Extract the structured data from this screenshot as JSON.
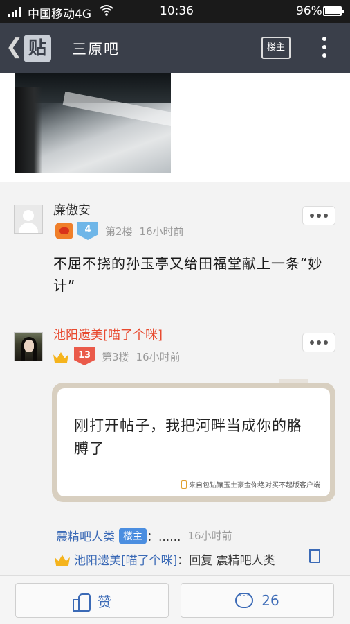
{
  "status_bar": {
    "carrier": "中国移动4G",
    "time": "10:36",
    "battery": "96%",
    "battery_level": 0.96
  },
  "nav": {
    "back_icon": "chevron-left-icon",
    "logo_text": "贴",
    "title": "三原吧",
    "louzhu_button": "楼主",
    "more_icon": "vertical-dots-icon"
  },
  "floors": [
    {
      "username": "廉傲安",
      "level": "4",
      "floor": "第2楼",
      "time": "16小时前",
      "content": "不屈不挠的孙玉亭又给田福堂献上一条“妙计”"
    },
    {
      "username": "池阳遗美[喵了个咪]",
      "level": "13",
      "floor": "第3楼",
      "time": "16小时前",
      "content": "刚打开帖子，我把河畔当成你的胳膊了",
      "source": "来自包钻镶玉土豪金你绝对买不起版客户端",
      "replies": [
        {
          "name": "震精吧人类",
          "tag": "楼主",
          "content": "：......",
          "time": "16小时前"
        },
        {
          "name": "池阳遗美[喵了个咪]",
          "content": "：回复 震精吧人类"
        }
      ]
    }
  ],
  "bottom": {
    "like_label": "赞",
    "comment_count": "26"
  },
  "colors": {
    "navbar": "#3a3f4a",
    "accent_blue": "#3b6ab6",
    "red_name": "#e84a2f",
    "quote_frame": "#d8cfc0"
  }
}
